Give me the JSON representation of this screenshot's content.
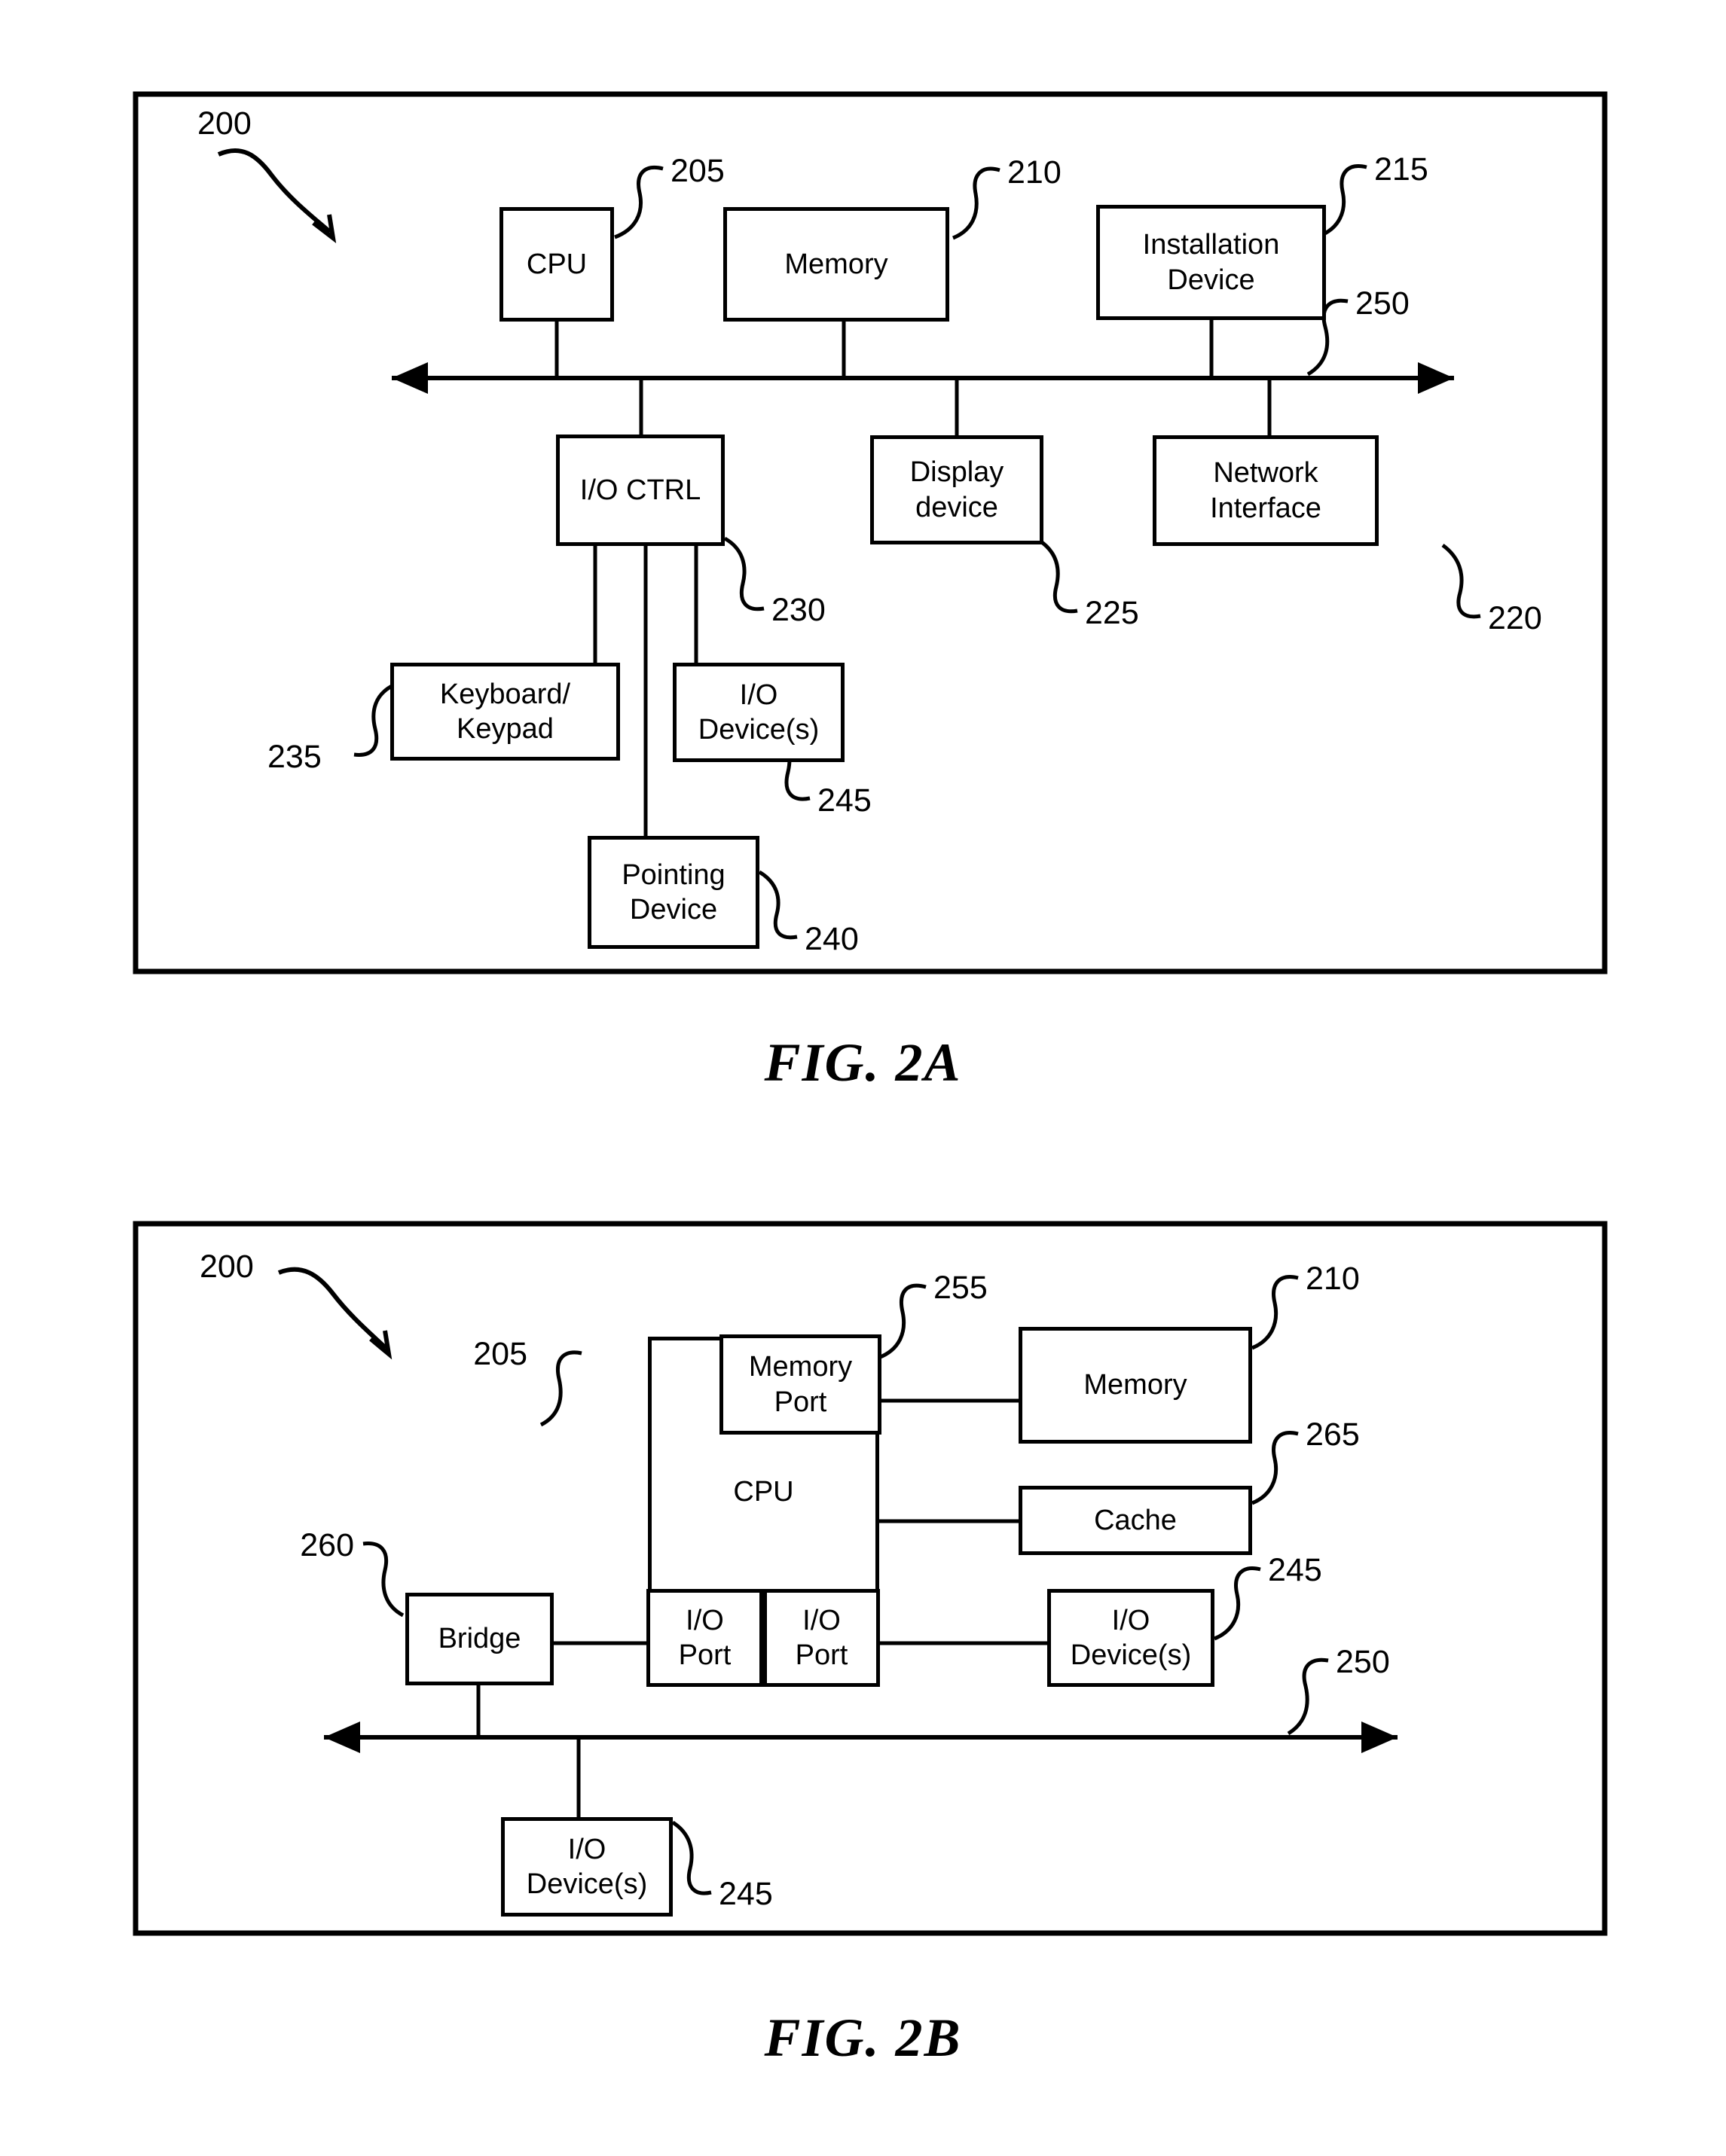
{
  "figures": [
    {
      "id": "fig-2a",
      "caption": "FIG. 2A",
      "system_ref": "200",
      "bus_ref": "250",
      "nodes": {
        "cpu": {
          "label": "CPU",
          "ref": "205"
        },
        "memory": {
          "label": "Memory",
          "ref": "210"
        },
        "installation_device": {
          "label_line1": "Installation",
          "label_line2": "Device",
          "ref": "215"
        },
        "io_ctrl": {
          "label": "I/O CTRL",
          "ref": "230"
        },
        "display_device": {
          "label_line1": "Display",
          "label_line2": "device",
          "ref": "225"
        },
        "network_interface": {
          "label_line1": "Network",
          "label_line2": "Interface",
          "ref": "220"
        },
        "keyboard_keypad": {
          "label_line1": "Keyboard/",
          "label_line2": "Keypad",
          "ref": "235"
        },
        "io_devices": {
          "label_line1": "I/O",
          "label_line2": "Device(s)",
          "ref": "245"
        },
        "pointing_device": {
          "label_line1": "Pointing",
          "label_line2": "Device",
          "ref": "240"
        }
      }
    },
    {
      "id": "fig-2b",
      "caption": "FIG. 2B",
      "system_ref": "200",
      "bus_ref": "250",
      "nodes": {
        "cpu": {
          "label": "CPU",
          "ref": "205"
        },
        "memory_port": {
          "label_line1": "Memory",
          "label_line2": "Port",
          "ref": "255"
        },
        "memory": {
          "label": "Memory",
          "ref": "210"
        },
        "cache": {
          "label": "Cache",
          "ref": "265"
        },
        "io_port_left": {
          "label_line1": "I/O",
          "label_line2": "Port"
        },
        "io_port_right": {
          "label_line1": "I/O",
          "label_line2": "Port"
        },
        "bridge": {
          "label": "Bridge",
          "ref": "260"
        },
        "io_devices_right": {
          "label_line1": "I/O",
          "label_line2": "Device(s)",
          "ref": "245"
        },
        "io_devices_bottom": {
          "label_line1": "I/O",
          "label_line2": "Device(s)",
          "ref": "245"
        }
      }
    }
  ],
  "colors": {
    "stroke": "#000000",
    "background": "#ffffff"
  }
}
